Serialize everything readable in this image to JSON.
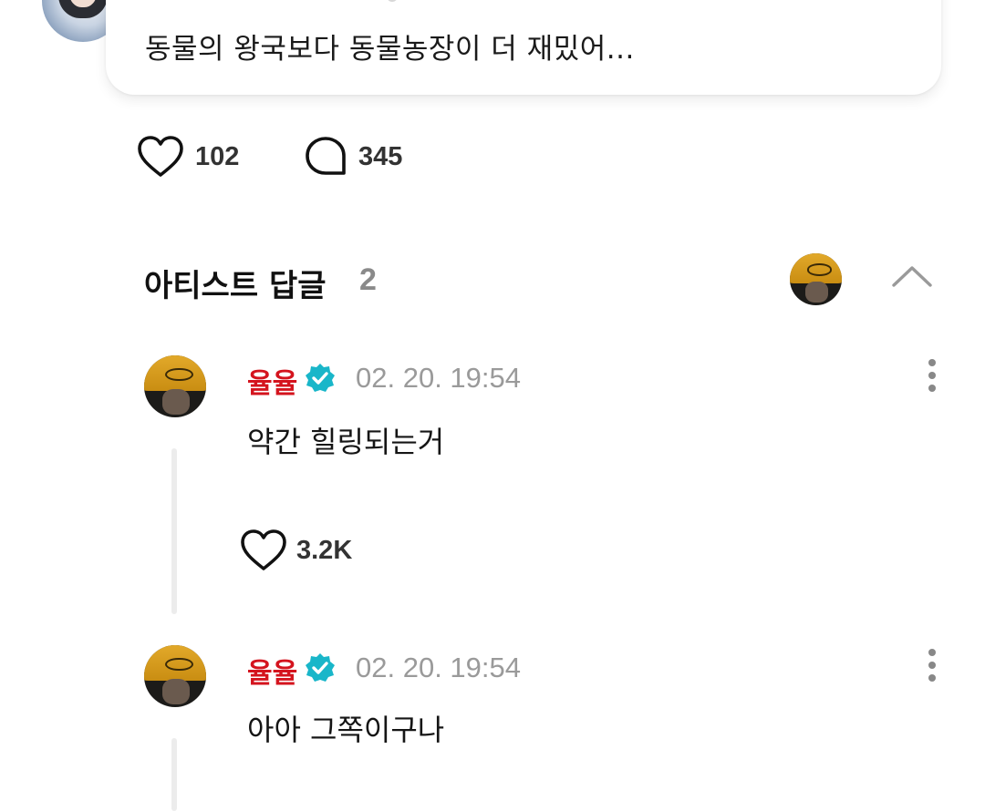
{
  "post": {
    "text": "동물의 왕국보다 동물농장이 더 재밌어...",
    "like_count": "102",
    "comment_count": "345"
  },
  "artist_replies": {
    "title": "아티스트 답글",
    "count": "2"
  },
  "replies": [
    {
      "author": "율율",
      "time": "02. 20. 19:54",
      "text": "약간 힐링되는거",
      "like_count": "3.2K"
    },
    {
      "author": "율율",
      "time": "02. 20. 19:54",
      "text": "아아 그쪽이구나"
    }
  ],
  "colors": {
    "author_name": "#d4141e",
    "verified_badge": "#19b6c9",
    "timestamp": "#9a9a9a"
  },
  "icons": [
    "heart-icon",
    "comment-bubble-icon",
    "verified-badge-icon",
    "chevron-up-icon",
    "more-vertical-icon"
  ]
}
